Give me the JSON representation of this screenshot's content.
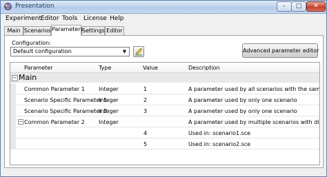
{
  "window": {
    "title": "Presentation",
    "min_symbol": "–",
    "max_symbol": "□",
    "close_symbol": "✕"
  },
  "menu": [
    "Experiment",
    "Editor",
    "Tools",
    "License",
    "Help"
  ],
  "tabs": [
    "Main",
    "Scenarios",
    "Parameters",
    "Settings",
    "Editor"
  ],
  "active_tab": "Parameters",
  "configuration": {
    "label": "Configuration:",
    "selected": "Default configuration",
    "dropdown_icon": "chevron-down-icon",
    "edit_icon": "pencil-icon"
  },
  "advanced_button": "Advanced parameter editor",
  "grid": {
    "columns": [
      "Parameter",
      "Type",
      "Value",
      "Description"
    ],
    "group": {
      "label": "Main",
      "toggle": "−"
    },
    "rows": [
      {
        "parameter": "Common Parameter 1",
        "type": "Integer",
        "value": "1",
        "description": "A parameter used by all scenarios with the same value"
      },
      {
        "parameter": "Scenario Specific Parameter 1",
        "type": "Integer",
        "value": "2",
        "description": "A parameter used by only one scenario"
      },
      {
        "parameter": "Scenario Specific Parameter 2",
        "type": "Integer",
        "value": "3",
        "description": "A parameter used by only one scenario"
      },
      {
        "parameter": "Common Parameter 2",
        "type": "Integer",
        "value": "",
        "description": "A parameter used by multiple scenarios with different values",
        "toggle": "−"
      },
      {
        "parameter": "",
        "type": "",
        "value": "4",
        "description": "Used in: scenario1.sce"
      },
      {
        "parameter": "",
        "type": "",
        "value": "5",
        "description": "Used in: scenario2.sce"
      }
    ]
  },
  "colors": {
    "titlebar": "#c8daf1",
    "close_button": "#c03a22",
    "group_row": "#e9e9e9"
  }
}
